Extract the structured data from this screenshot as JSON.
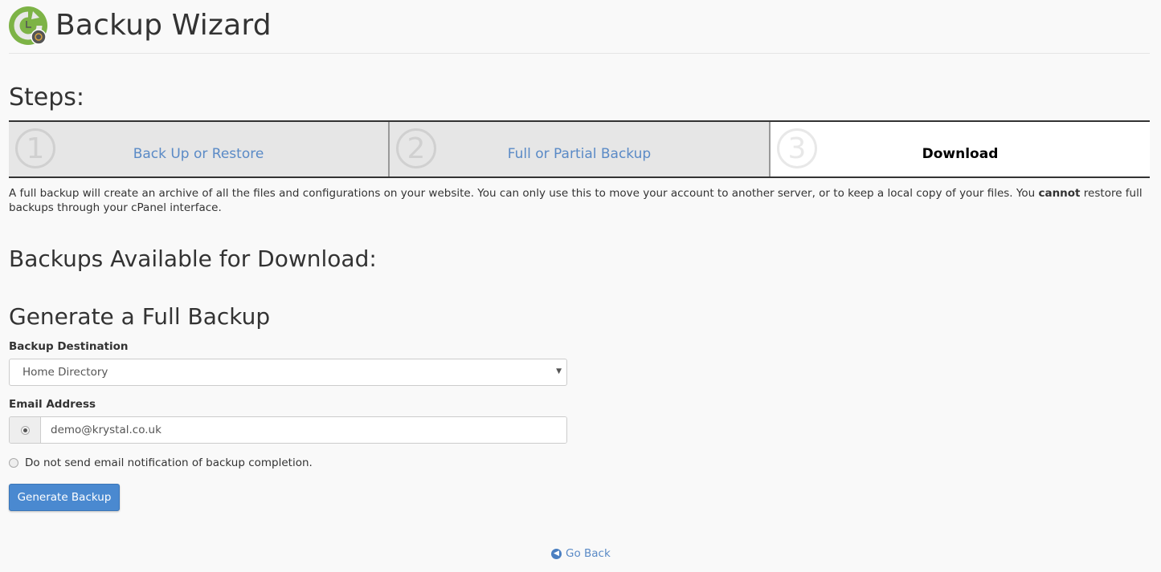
{
  "header": {
    "title": "Backup Wizard",
    "icon": "backup-wizard-icon"
  },
  "steps": {
    "title": "Steps:",
    "items": [
      {
        "number": "1",
        "label": "Back Up or Restore",
        "active": false
      },
      {
        "number": "2",
        "label": "Full or Partial Backup",
        "active": false
      },
      {
        "number": "3",
        "label": "Download",
        "active": true
      }
    ]
  },
  "description": {
    "text_before": "A full backup will create an archive of all the files and configurations on your website. You can only use this to move your account to another server, or to keep a local copy of your files. You ",
    "bold": "cannot",
    "text_after": " restore full backups through your cPanel interface."
  },
  "available": {
    "heading": "Backups Available for Download:"
  },
  "generate": {
    "heading": "Generate a Full Backup",
    "destination_label": "Backup Destination",
    "destination_value": "Home Directory",
    "email_label": "Email Address",
    "email_value": "demo@krystal.co.uk",
    "no_email_label": "Do not send email notification of backup completion.",
    "submit_label": "Generate Backup"
  },
  "footer": {
    "go_back_label": "Go Back"
  },
  "colors": {
    "accent": "#4a89d0",
    "link": "#5a8ac6",
    "icon_green": "#7db346"
  }
}
